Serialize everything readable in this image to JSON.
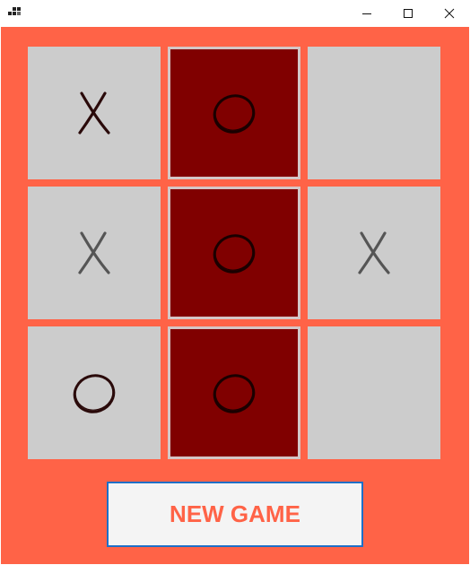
{
  "window": {
    "title": "",
    "icons": {
      "app": "app-icon",
      "minimize": "minimize-icon",
      "maximize": "maximize-icon",
      "close": "close-icon"
    }
  },
  "colors": {
    "background": "#ff6347",
    "cell": "#cccccc",
    "winning_cell": "#800000",
    "button_text": "#ff6347"
  },
  "board": {
    "cells": [
      {
        "mark": "X",
        "winning": false,
        "color": "#2a0a0a"
      },
      {
        "mark": "O",
        "winning": true,
        "color": "#1a0000"
      },
      {
        "mark": "",
        "winning": false,
        "color": ""
      },
      {
        "mark": "X",
        "winning": false,
        "color": "#555555"
      },
      {
        "mark": "O",
        "winning": true,
        "color": "#1a0000"
      },
      {
        "mark": "X",
        "winning": false,
        "color": "#555555"
      },
      {
        "mark": "O",
        "winning": false,
        "color": "#2a0a0a"
      },
      {
        "mark": "O",
        "winning": true,
        "color": "#1a0000"
      },
      {
        "mark": "",
        "winning": false,
        "color": ""
      }
    ]
  },
  "new_game_button": {
    "label": "NEW GAME"
  }
}
